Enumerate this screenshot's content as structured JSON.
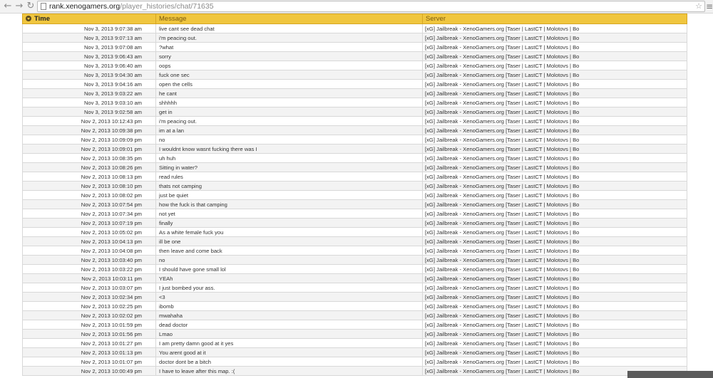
{
  "browser": {
    "back_glyph": "←",
    "forward_glyph": "→",
    "reload_glyph": "↻",
    "url_host": "rank.xenogamers.org",
    "url_path": "/player_histories/chat/71635",
    "star_glyph": "☆",
    "menu_glyph": "≡"
  },
  "table": {
    "headers": {
      "time": "Time",
      "message": "Message",
      "server": "Server"
    },
    "rows": [
      {
        "time": "Nov 3, 2013 9:07:38 am",
        "message": "live cant see dead chat",
        "server": "[xG] Jailbreak - XenoGamers.org [Taser | LastCT | Molotovs | Bo"
      },
      {
        "time": "Nov 3, 2013 9:07:13 am",
        "message": "i'm peacing out.",
        "server": "[xG] Jailbreak - XenoGamers.org [Taser | LastCT | Molotovs | Bo"
      },
      {
        "time": "Nov 3, 2013 9:07:08 am",
        "message": "?what",
        "server": "[xG] Jailbreak - XenoGamers.org [Taser | LastCT | Molotovs | Bo"
      },
      {
        "time": "Nov 3, 2013 9:06:43 am",
        "message": "sorry",
        "server": "[xG] Jailbreak - XenoGamers.org [Taser | LastCT | Molotovs | Bo"
      },
      {
        "time": "Nov 3, 2013 9:06:40 am",
        "message": "oops",
        "server": "[xG] Jailbreak - XenoGamers.org [Taser | LastCT | Molotovs | Bo"
      },
      {
        "time": "Nov 3, 2013 9:04:30 am",
        "message": "fuck one sec",
        "server": "[xG] Jailbreak - XenoGamers.org [Taser | LastCT | Molotovs | Bo"
      },
      {
        "time": "Nov 3, 2013 9:04:16 am",
        "message": "open the cells",
        "server": "[xG] Jailbreak - XenoGamers.org [Taser | LastCT | Molotovs | Bo"
      },
      {
        "time": "Nov 3, 2013 9:03:22 am",
        "message": "he cant",
        "server": "[xG] Jailbreak - XenoGamers.org [Taser | LastCT | Molotovs | Bo"
      },
      {
        "time": "Nov 3, 2013 9:03:10 am",
        "message": "shhhhh",
        "server": "[xG] Jailbreak - XenoGamers.org [Taser | LastCT | Molotovs | Bo"
      },
      {
        "time": "Nov 3, 2013 9:02:58 am",
        "message": "get in",
        "server": "[xG] Jailbreak - XenoGamers.org [Taser | LastCT | Molotovs | Bo"
      },
      {
        "time": "Nov 2, 2013 10:12:43 pm",
        "message": "i'm peacing out.",
        "server": "[xG] Jailbreak - XenoGamers.org [Taser | LastCT | Molotovs | Bo"
      },
      {
        "time": "Nov 2, 2013 10:09:38 pm",
        "message": "im at a lan",
        "server": "[xG] Jailbreak - XenoGamers.org [Taser | LastCT | Molotovs | Bo"
      },
      {
        "time": "Nov 2, 2013 10:09:09 pm",
        "message": "no",
        "server": "[xG] Jailbreak - XenoGamers.org [Taser | LastCT | Molotovs | Bo"
      },
      {
        "time": "Nov 2, 2013 10:09:01 pm",
        "message": "I wouldnt know wasnt fucking there was I",
        "server": "[xG] Jailbreak - XenoGamers.org [Taser | LastCT | Molotovs | Bo"
      },
      {
        "time": "Nov 2, 2013 10:08:35 pm",
        "message": "uh huh",
        "server": "[xG] Jailbreak - XenoGamers.org [Taser | LastCT | Molotovs | Bo"
      },
      {
        "time": "Nov 2, 2013 10:08:26 pm",
        "message": "Sitting in water?",
        "server": "[xG] Jailbreak - XenoGamers.org [Taser | LastCT | Molotovs | Bo"
      },
      {
        "time": "Nov 2, 2013 10:08:13 pm",
        "message": "read rules",
        "server": "[xG] Jailbreak - XenoGamers.org [Taser | LastCT | Molotovs | Bo"
      },
      {
        "time": "Nov 2, 2013 10:08:10 pm",
        "message": "thats not camping",
        "server": "[xG] Jailbreak - XenoGamers.org [Taser | LastCT | Molotovs | Bo"
      },
      {
        "time": "Nov 2, 2013 10:08:02 pm",
        "message": "just be quiet",
        "server": "[xG] Jailbreak - XenoGamers.org [Taser | LastCT | Molotovs | Bo"
      },
      {
        "time": "Nov 2, 2013 10:07:54 pm",
        "message": "how the fuck is that camping",
        "server": "[xG] Jailbreak - XenoGamers.org [Taser | LastCT | Molotovs | Bo"
      },
      {
        "time": "Nov 2, 2013 10:07:34 pm",
        "message": "not yet",
        "server": "[xG] Jailbreak - XenoGamers.org [Taser | LastCT | Molotovs | Bo"
      },
      {
        "time": "Nov 2, 2013 10:07:19 pm",
        "message": "finally",
        "server": "[xG] Jailbreak - XenoGamers.org [Taser | LastCT | Molotovs | Bo"
      },
      {
        "time": "Nov 2, 2013 10:05:02 pm",
        "message": "As a white female fuck you",
        "server": "[xG] Jailbreak - XenoGamers.org [Taser | LastCT | Molotovs | Bo"
      },
      {
        "time": "Nov 2, 2013 10:04:13 pm",
        "message": "ill be one",
        "server": "[xG] Jailbreak - XenoGamers.org [Taser | LastCT | Molotovs | Bo"
      },
      {
        "time": "Nov 2, 2013 10:04:08 pm",
        "message": "then leave and come back",
        "server": "[xG] Jailbreak - XenoGamers.org [Taser | LastCT | Molotovs | Bo"
      },
      {
        "time": "Nov 2, 2013 10:03:40 pm",
        "message": "no",
        "server": "[xG] Jailbreak - XenoGamers.org [Taser | LastCT | Molotovs | Bo"
      },
      {
        "time": "Nov 2, 2013 10:03:22 pm",
        "message": "I should have gone small lol",
        "server": "[xG] Jailbreak - XenoGamers.org [Taser | LastCT | Molotovs | Bo"
      },
      {
        "time": "Nov 2, 2013 10:03:11 pm",
        "message": "YEAh",
        "server": "[xG] Jailbreak - XenoGamers.org [Taser | LastCT | Molotovs | Bo"
      },
      {
        "time": "Nov 2, 2013 10:03:07 pm",
        "message": "I just bombed your ass.",
        "server": "[xG] Jailbreak - XenoGamers.org [Taser | LastCT | Molotovs | Bo"
      },
      {
        "time": "Nov 2, 2013 10:02:34 pm",
        "message": "<3",
        "server": "[xG] Jailbreak - XenoGamers.org [Taser | LastCT | Molotovs | Bo"
      },
      {
        "time": "Nov 2, 2013 10:02:25 pm",
        "message": "ibomb",
        "server": "[xG] Jailbreak - XenoGamers.org [Taser | LastCT | Molotovs | Bo"
      },
      {
        "time": "Nov 2, 2013 10:02:02 pm",
        "message": "mwahaha",
        "server": "[xG] Jailbreak - XenoGamers.org [Taser | LastCT | Molotovs | Bo"
      },
      {
        "time": "Nov 2, 2013 10:01:59 pm",
        "message": "dead doctor",
        "server": "[xG] Jailbreak - XenoGamers.org [Taser | LastCT | Molotovs | Bo"
      },
      {
        "time": "Nov 2, 2013 10:01:56 pm",
        "message": "Lmao",
        "server": "[xG] Jailbreak - XenoGamers.org [Taser | LastCT | Molotovs | Bo"
      },
      {
        "time": "Nov 2, 2013 10:01:27 pm",
        "message": "I am pretty damn good at it yes",
        "server": "[xG] Jailbreak - XenoGamers.org [Taser | LastCT | Molotovs | Bo"
      },
      {
        "time": "Nov 2, 2013 10:01:13 pm",
        "message": "You arent good at it",
        "server": "[xG] Jailbreak - XenoGamers.org [Taser | LastCT | Molotovs | Bo"
      },
      {
        "time": "Nov 2, 2013 10:01:07 pm",
        "message": "doctor dont be a bitch",
        "server": "[xG] Jailbreak - XenoGamers.org [Taser | LastCT | Molotovs | Bo"
      },
      {
        "time": "Nov 2, 2013 10:00:49 pm",
        "message": "I have to leave after this map. :(",
        "server": "[xG] Jailbreak - XenoGamers.org [Taser | LastCT | Molotovs | Bo"
      }
    ]
  },
  "colors": {
    "header_bg": "#f0c63f",
    "row_alt": "#f3f3f3"
  }
}
